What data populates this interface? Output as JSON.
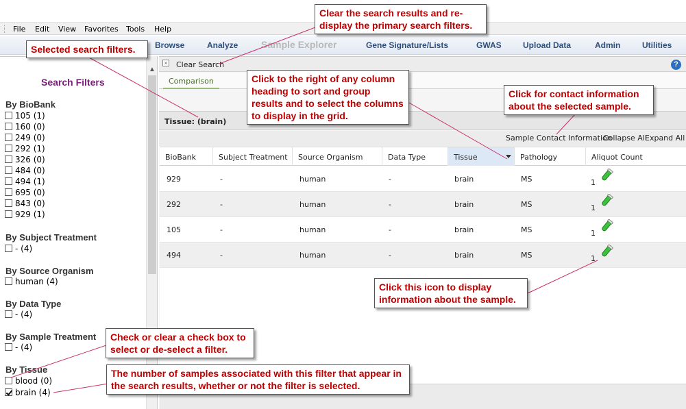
{
  "menu": [
    "File",
    "Edit",
    "View",
    "Favorites",
    "Tools",
    "Help"
  ],
  "nav": {
    "items": [
      "Browse",
      "Analyze",
      "Sample Explorer",
      "Gene Signature/Lists",
      "GWAS",
      "Upload Data",
      "Admin",
      "Utilities"
    ],
    "active": "Sample Explorer"
  },
  "filters": {
    "title": "Search Filters",
    "groups": [
      {
        "label": "By BioBank",
        "items": [
          {
            "label": "105 (1)",
            "checked": false
          },
          {
            "label": "160 (0)",
            "checked": false
          },
          {
            "label": "249 (0)",
            "checked": false
          },
          {
            "label": "292 (1)",
            "checked": false
          },
          {
            "label": "326 (0)",
            "checked": false
          },
          {
            "label": "484 (0)",
            "checked": false
          },
          {
            "label": "494 (1)",
            "checked": false
          },
          {
            "label": "695 (0)",
            "checked": false
          },
          {
            "label": "843 (0)",
            "checked": false
          },
          {
            "label": "929 (1)",
            "checked": false
          }
        ]
      },
      {
        "label": "By Subject Treatment",
        "items": [
          {
            "label": "- (4)",
            "checked": false
          }
        ]
      },
      {
        "label": "By Source Organism",
        "items": [
          {
            "label": "human (4)",
            "checked": false
          }
        ]
      },
      {
        "label": "By Data Type",
        "items": [
          {
            "label": "- (4)",
            "checked": false
          }
        ]
      },
      {
        "label": "By Sample Treatment",
        "items": [
          {
            "label": "- (4)",
            "checked": false
          }
        ]
      },
      {
        "label": "By Tissue",
        "items": [
          {
            "label": "blood (0)",
            "checked": false
          },
          {
            "label": "brain (4)",
            "checked": true
          }
        ]
      }
    ]
  },
  "toolbar": {
    "clear_search": "Clear Search",
    "help": "?"
  },
  "tabs": [
    "Comparison"
  ],
  "group_header": "Tissue: (brain)",
  "actions": {
    "contact": "Sample Contact Information",
    "collapse": "Collapse All",
    "expand": "Expand All"
  },
  "grid": {
    "columns": [
      "BioBank",
      "Subject Treatment",
      "Source Organism",
      "Data Type",
      "Tissue",
      "Pathology",
      "Aliquot Count"
    ],
    "sorted_column": "Tissue",
    "rows": [
      [
        "929",
        "-",
        "human",
        "-",
        "brain",
        "MS",
        "1"
      ],
      [
        "292",
        "-",
        "human",
        "-",
        "brain",
        "MS",
        "1"
      ],
      [
        "105",
        "-",
        "human",
        "-",
        "brain",
        "MS",
        "1"
      ],
      [
        "494",
        "-",
        "human",
        "-",
        "brain",
        "MS",
        "1"
      ]
    ]
  },
  "callouts": {
    "clear": "Clear the search results and re-display the primary search filters.",
    "selected": "Selected search filters.",
    "sort": "Click to the right of any column heading to sort and group results and to select the columns to display in the grid.",
    "contact": "Click for contact information about the selected sample.",
    "icon": "Click this icon to display information about the sample.",
    "checkbox": "Check or clear a check box to select or de-select a filter.",
    "count": "The number of samples associated with this filter that appear in the search results, whether or not the filter is selected."
  },
  "colors": {
    "callout_text": "#c00000",
    "nav_text": "#2e4f7c",
    "filter_title": "#7a1f7a",
    "tube": "#3cc23c"
  }
}
